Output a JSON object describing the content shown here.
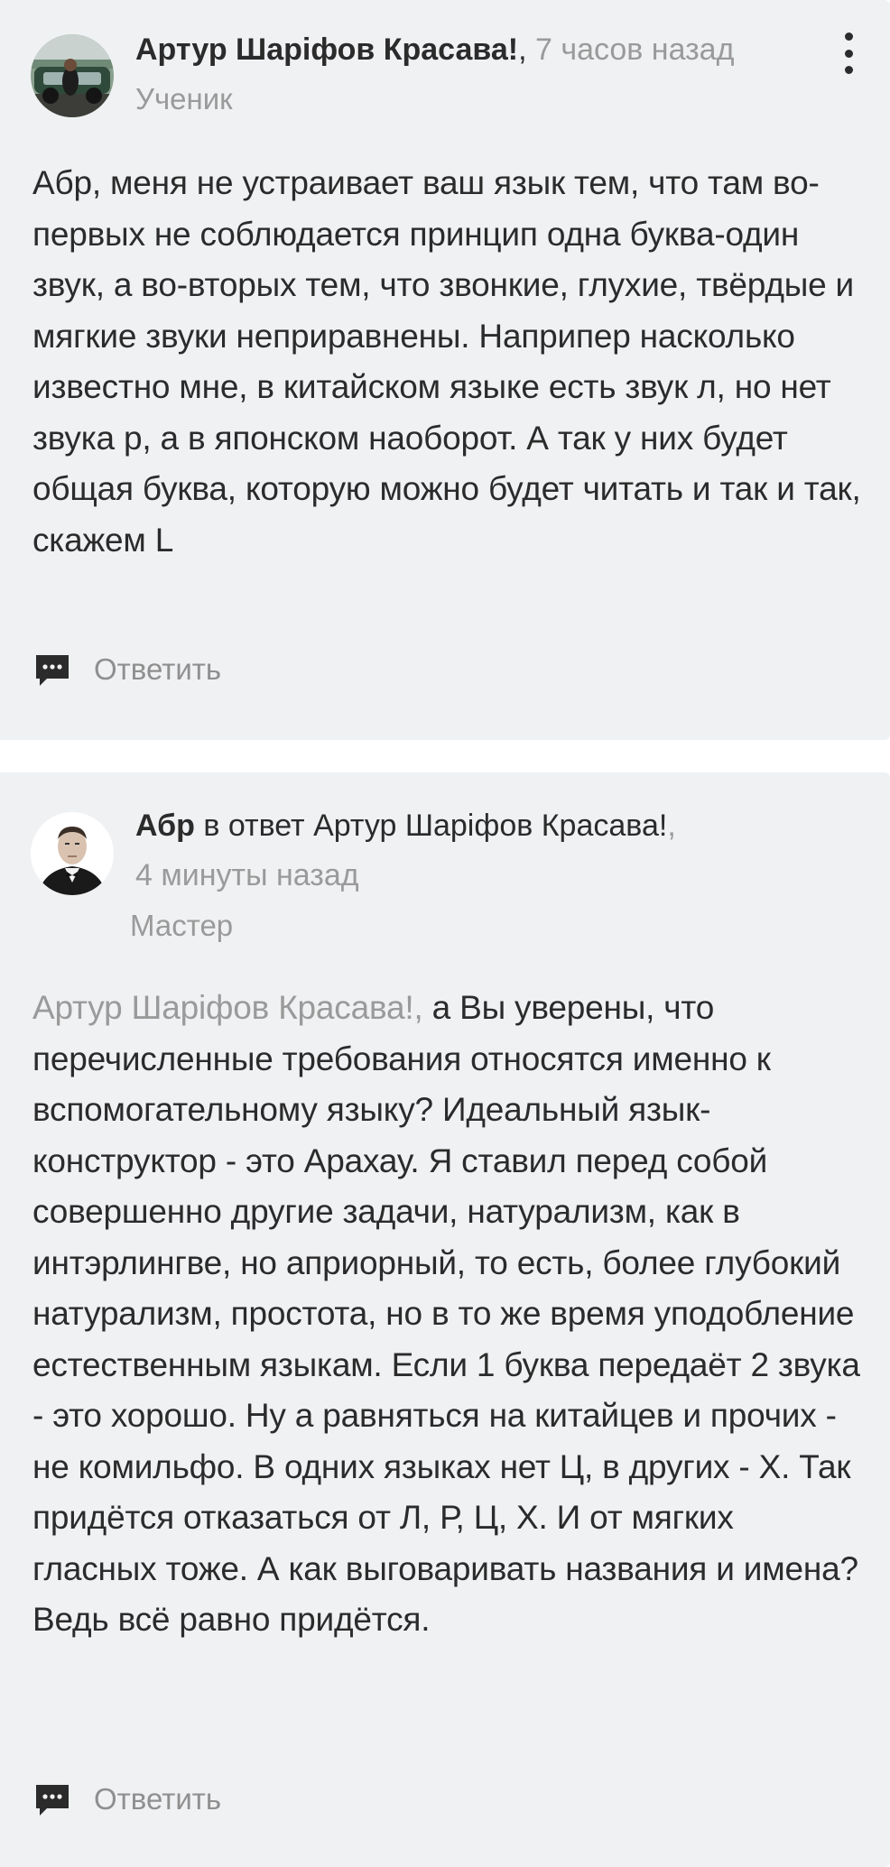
{
  "comments": [
    {
      "author": "Артур Шаріфов Красава!",
      "comma": ",",
      "time": "7 часов назад",
      "rank": "Ученик",
      "body": "Абр, меня не устраивает ваш язык тем, что там во-первых не соблюдается принцип одна буква-один звук, а во-вторых тем, что звонкие, глухие, твёрдые и мягкие звуки неприравнены. Наприпер насколько известно мне, в китайском языке есть звук л, но нет звука р, а в японском наоборот. А так у них будет общая буква, которую можно будет читать и так и так, скажем L",
      "reply_label": "Ответить"
    },
    {
      "author": "Абр",
      "reply_word": "в ответ",
      "reply_to": "Артур Шаріфов Красава!",
      "comma": ",",
      "time": "4 минуты назад",
      "rank": "Мастер",
      "mention": "Артур Шаріфов Красава!,",
      "body": " а Вы уверены, что перечисленные требования относятся именно к вспомогательному языку? Идеальный язык-конструктор - это Арахау. Я ставил перед собой совершенно другие задачи, натурализм, как в интэрлингве, но априорный, то есть, более глубокий натурализм, простота, но в то же время уподобление естественным языкам. Если 1 буква передаёт 2 звука - это хорошо. Ну а равняться на китайцев и прочих - не комильфо. В одних языках нет Ц, в других - Х. Так придётся отказаться от Л, Р, Ц, Х. И от мягких гласных тоже. А как выговаривать названия и имена? Ведь всё равно придётся.",
      "reply_label": "Ответить"
    }
  ],
  "icons": {
    "menu": "more-vertical-icon",
    "reply": "speech-bubble-icon"
  },
  "colors": {
    "card_bg": "#f0f1f3",
    "text": "#2b2b2b",
    "muted": "#9a9a9a"
  }
}
